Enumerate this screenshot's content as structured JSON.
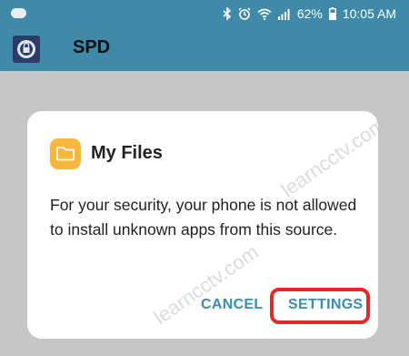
{
  "status_bar": {
    "battery": "62%",
    "time": "10:05 AM",
    "icons": [
      "notification-pill-icon",
      "bluetooth-icon",
      "alarm-icon",
      "wifi-icon",
      "signal-icon",
      "battery-icon"
    ]
  },
  "app_bar": {
    "title": "SPD",
    "icon": "spd-app-icon"
  },
  "dialog": {
    "icon": "folder-icon",
    "title": "My Files",
    "message": "For your security, your phone is not allowed to install unknown apps from this source.",
    "cancel_label": "CANCEL",
    "settings_label": "SETTINGS"
  },
  "watermark": "learncctv.com",
  "colors": {
    "status_bar": "#3e8aa8",
    "scrim": "#c6c6c6",
    "dialog": "#ffffff",
    "button_text": "#3a8db1",
    "highlight": "#e32a2a",
    "folder": "#f6b73c"
  }
}
